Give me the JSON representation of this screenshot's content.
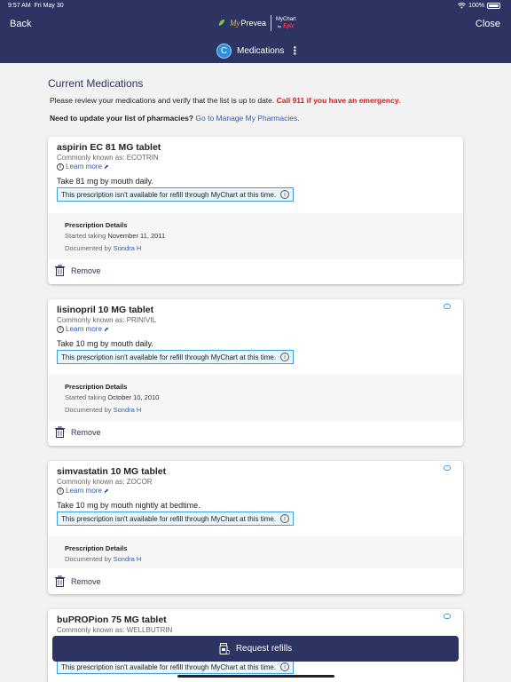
{
  "status_bar": {
    "time": "9:57 AM",
    "date": "Fri May 30",
    "battery": "100%",
    "battery_level": 1.0
  },
  "header": {
    "back_label": "Back",
    "close_label": "Close",
    "logo_my": "My",
    "logo_prevea": "Prevea",
    "logo_mychart": "MyChart",
    "logo_by": "by",
    "logo_epic": "Epic",
    "avatar_letter": "C",
    "page_title": "Medications"
  },
  "section_title": "Current Medications",
  "intro_text": "Please review your medications and verify that the list is up to date.",
  "emergency_text": "Call 911 if you have an emergency.",
  "pharmacy_prompt": "Need to update your list of pharmacies?",
  "pharmacy_link": "Go to Manage My Pharmacies.",
  "learn_more": "Learn more",
  "refill_unavailable": "This prescription isn't available for refill through MyChart at this time.",
  "pd_title": "Prescription Details",
  "started_label": "Started taking",
  "documented_label": "Documented by",
  "remove_label": "Remove",
  "medications": [
    {
      "name": "aspirin EC 81 MG tablet",
      "known_as": "Commonly known as: ECOTRIN",
      "sig": "Take 81 mg by mouth daily.",
      "started": "November 11, 2011",
      "documented_by": "Sondra H"
    },
    {
      "name": "lisinopril 10 MG tablet",
      "known_as": "Commonly known as: PRINIVIL",
      "sig": "Take 10 mg by mouth daily.",
      "started": "October 10, 2010",
      "documented_by": "Sondra H"
    },
    {
      "name": "simvastatin 10 MG tablet",
      "known_as": "Commonly known as: ZOCOR",
      "sig": "Take 10 mg by mouth nightly at bedtime.",
      "documented_by": "Sondra H"
    },
    {
      "name": "buPROPion 75 MG tablet",
      "known_as": "Commonly known as: WELLBUTRIN"
    }
  ],
  "request_refills_label": "Request refills",
  "colors": {
    "header": "#2e3461",
    "link": "#2e5da8",
    "warning": "#d11d1d",
    "refill_border": "#3da0db"
  }
}
